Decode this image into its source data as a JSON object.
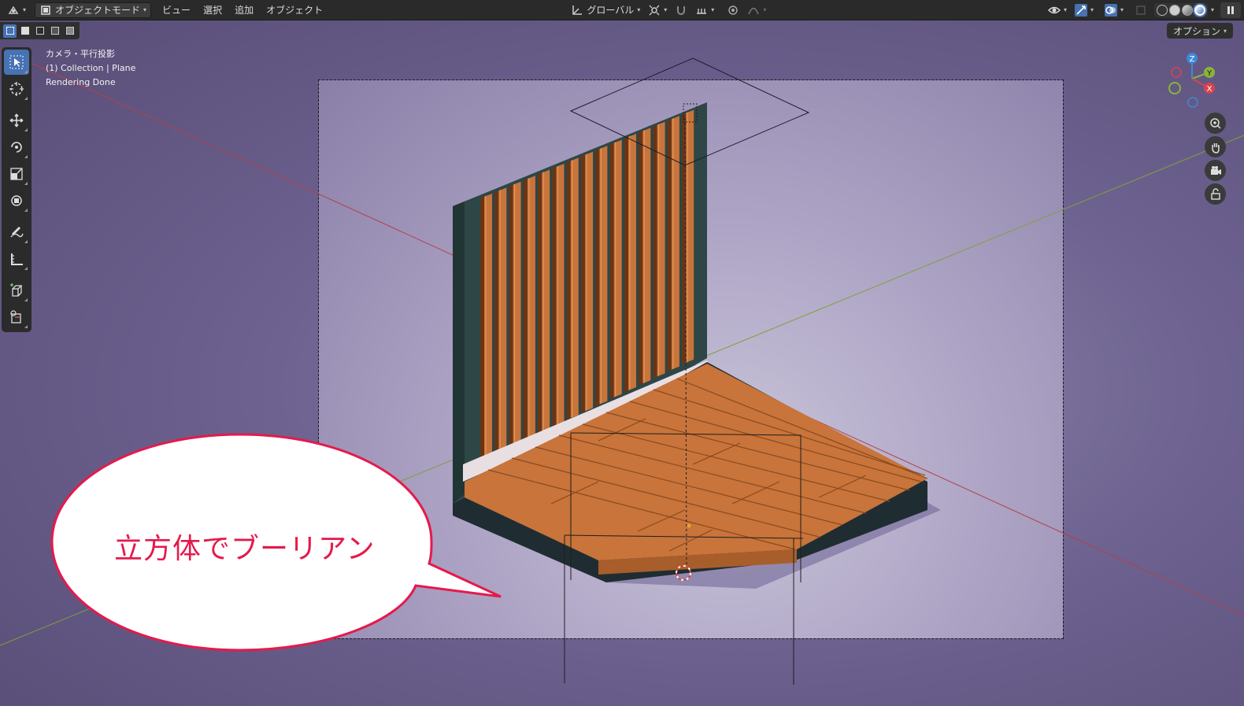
{
  "header": {
    "mode_label": "オブジェクトモード",
    "menus": [
      "ビュー",
      "選択",
      "追加",
      "オブジェクト"
    ],
    "transform_orientation": "グローバル"
  },
  "options_label": "オプション",
  "overlay_info": {
    "line1": "カメラ・平行投影",
    "line2": "(1) Collection | Plane",
    "line3": "Rendering Done"
  },
  "gizmo": {
    "x": "X",
    "y": "Y",
    "z": "Z"
  },
  "callout": {
    "text": "立方体でブーリアン"
  },
  "colors": {
    "accent": "#4772b3",
    "callout_border": "#e6194b",
    "wood": "#c8743a",
    "wall": "#2e4646",
    "axis_x": "#d9424e",
    "axis_y": "#8ab33a",
    "axis_z": "#3f88d6"
  },
  "tools": [
    "select-box-icon",
    "cursor-icon",
    "move-icon",
    "rotate-icon",
    "scale-icon",
    "transform-icon",
    "annotate-icon",
    "measure-icon",
    "add-cube-icon",
    "scale-cage-icon"
  ]
}
